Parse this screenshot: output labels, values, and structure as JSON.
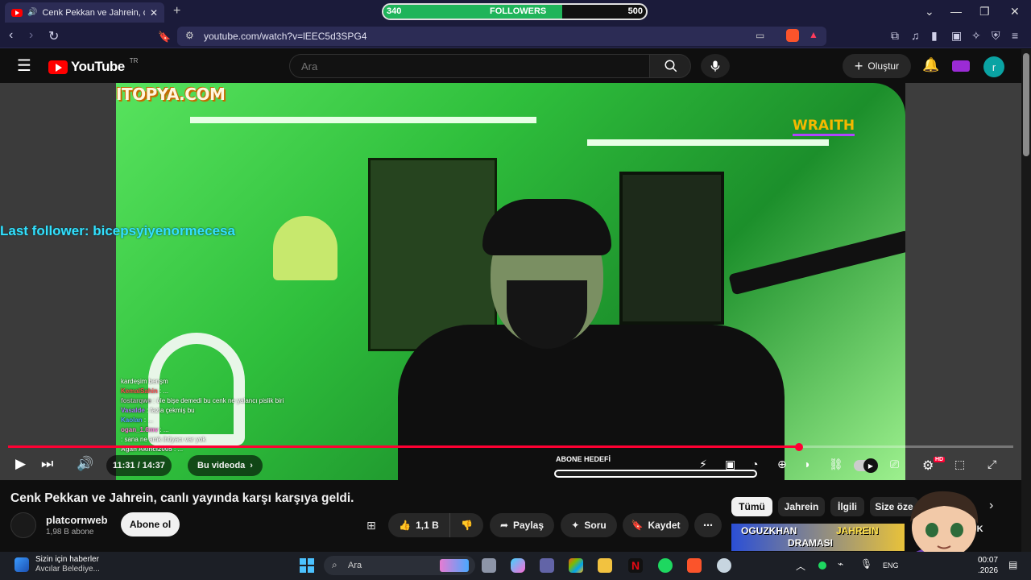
{
  "browser": {
    "tab_title": "Cenk Pekkan ve Jahrein, canlı",
    "url": "youtube.com/watch?v=lEEC5d3SPG4",
    "followers": {
      "label": "FOLLOWERS",
      "current": "340",
      "goal": "500",
      "progress": 0.68
    }
  },
  "youtube": {
    "logo_text": "YouTube",
    "region": "TR",
    "search_placeholder": "Ara",
    "create_label": "Oluştur",
    "avatar_letter": "r"
  },
  "stream_overlay": {
    "sponsor1": "ITOPYA.COM",
    "sponsor2": "WRAITH",
    "last_follower": "Last follower: bicepsyiyenormecesa",
    "abone_label": "ABONE HEDEFİ",
    "chat": [
      {
        "user": "",
        "msg": "kardeşim benşm"
      },
      {
        "user": "KemalSahin",
        "msg": ": ..."
      },
      {
        "user": "fostarqwe",
        "msg": ": öle bişe demedi bu cenk ne yalancı pislik biri"
      },
      {
        "user": "Vasalde",
        "msg": ": fazla çekmiş bu"
      },
      {
        "user": "Kaolan",
        "msg": ": ..."
      },
      {
        "user": "ogan_1.6mv",
        "msg": ": ..."
      },
      {
        "user": "",
        "msg": ": sana ne amk ihtiyacı var yok"
      },
      {
        "user": "Agan Akinci2005",
        "msg": ": ..."
      }
    ]
  },
  "player": {
    "current_time": "11:31",
    "duration": "14:37",
    "time_display": "11:31 / 14:37",
    "in_this_video": "Bu videoda",
    "progress": 0.787,
    "hd_badge": "HD"
  },
  "video": {
    "title": "Cenk Pekkan ve Jahrein, canlı yayında karşı karşıya geldi.",
    "channel": "platcornweb",
    "subscribers": "1,98 B abone",
    "subscribe_label": "Abone ol",
    "likes": "1,1 B",
    "share_label": "Paylaş",
    "ask_label": "Soru",
    "save_label": "Kaydet"
  },
  "chips": [
    "Tümü",
    "Jahrein",
    "İlgili",
    "Size öze"
  ],
  "recommended_thumb": {
    "line1": "OGUZKHAN",
    "line2": "JAHREIN",
    "line3": "DRAMASI",
    "side_text": "TÜK"
  },
  "taskbar": {
    "news_title": "Sizin için haberler",
    "news_sub": "Avcılar Belediye...",
    "search": "Ara",
    "lang": "ENG",
    "time": "00:07",
    "date": ".2026"
  }
}
